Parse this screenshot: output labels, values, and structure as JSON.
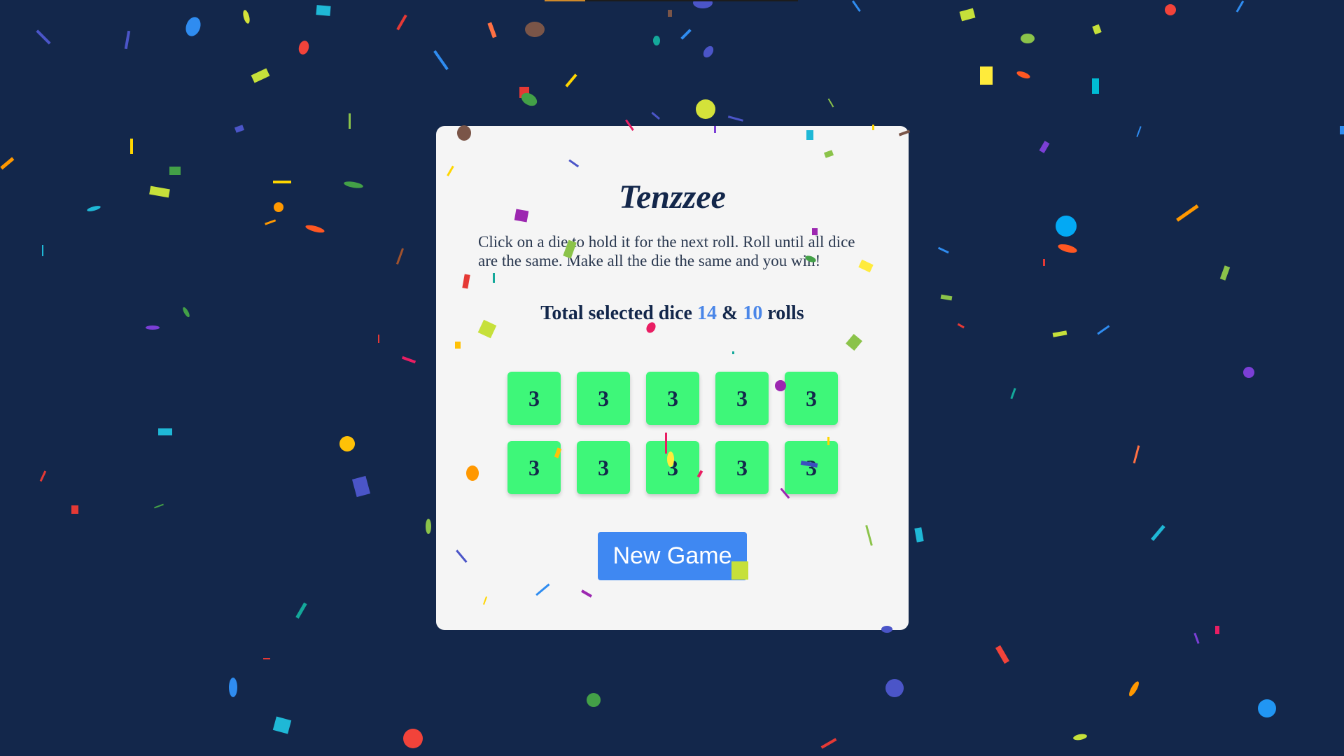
{
  "app": {
    "title": "Tenzzee",
    "instructions": "Click on a die to hold it for the next roll. Roll until all dice are the same. Make all the die the same and you win!",
    "stats": {
      "prefix": "Total selected dice",
      "selected_dice": "14",
      "joiner": "&",
      "rolls": "10",
      "suffix": "rolls"
    },
    "dice": [
      {
        "value": "3",
        "held": true
      },
      {
        "value": "3",
        "held": true
      },
      {
        "value": "3",
        "held": true
      },
      {
        "value": "3",
        "held": true
      },
      {
        "value": "3",
        "held": true
      },
      {
        "value": "3",
        "held": true
      },
      {
        "value": "3",
        "held": true
      },
      {
        "value": "3",
        "held": true
      },
      {
        "value": "3",
        "held": true
      },
      {
        "value": "3",
        "held": true
      }
    ],
    "new_game_label": "New Game",
    "progress": 0.16
  },
  "colors": {
    "background": "#13274b",
    "card": "#f5f5f5",
    "die_held": "#3ef779",
    "accent": "#4a86e8",
    "button": "#3f88f2",
    "text": "#13274b"
  }
}
